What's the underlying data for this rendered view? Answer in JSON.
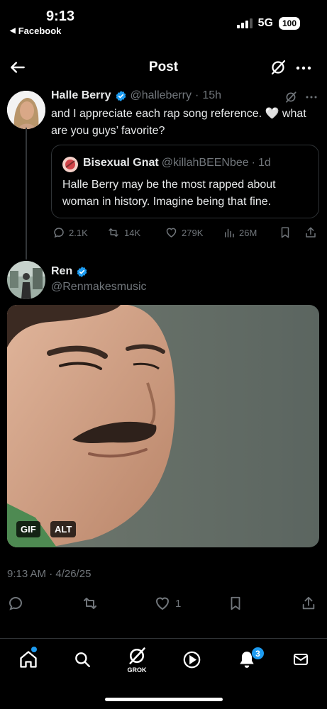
{
  "status_bar": {
    "time": "9:13",
    "back_app": "Facebook",
    "network": "5G",
    "battery": "100"
  },
  "header": {
    "title": "Post",
    "back_icon": "arrow-left-icon",
    "grok_icon": "grok-icon",
    "more_icon": "more-icon"
  },
  "parent_tweet": {
    "name": "Halle Berry",
    "handle": "@halleberry",
    "time": "15h",
    "text": "and I appreciate each rap song reference. 🤍 what are you guys’ favorite?",
    "quote": {
      "name": "Bisexual Gnat",
      "handle": "@killahBEENbee",
      "time": "1d",
      "text": "Halle Berry may be the most rapped about woman in history. Imagine being that fine."
    },
    "stats": {
      "replies": "2.1K",
      "reposts": "14K",
      "likes": "279K",
      "views": "26M"
    }
  },
  "reply": {
    "name": "Ren",
    "handle": "@Renmakesmusic",
    "media_badges": {
      "gif": "GIF",
      "alt": "ALT"
    },
    "timestamp": "9:13 AM · 4/26/25",
    "likes": "1"
  },
  "bottom_nav": {
    "grok_label": "GROK",
    "notifications_count": "3"
  },
  "colors": {
    "accent": "#1d9bf0",
    "muted": "#71767b",
    "background": "#000000"
  }
}
